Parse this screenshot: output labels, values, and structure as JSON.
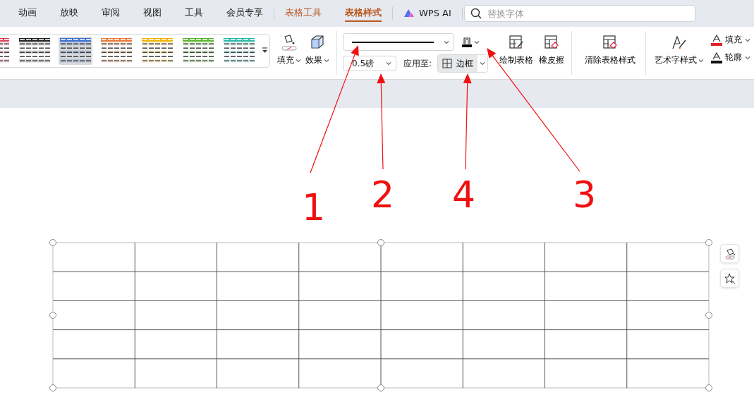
{
  "tabs": [
    {
      "label": "动画",
      "kind": "plain",
      "selected": false
    },
    {
      "label": "放映",
      "kind": "plain",
      "selected": false
    },
    {
      "label": "审阅",
      "kind": "plain",
      "selected": false
    },
    {
      "label": "视图",
      "kind": "plain",
      "selected": false
    },
    {
      "label": "工具",
      "kind": "plain",
      "selected": false
    },
    {
      "label": "会员专享",
      "kind": "plain",
      "selected": false
    },
    {
      "label": "表格工具",
      "kind": "context",
      "selected": false
    },
    {
      "label": "表格样式",
      "kind": "context",
      "selected": true
    },
    {
      "label": "WPS AI",
      "kind": "ai",
      "selected": false
    }
  ],
  "search": {
    "placeholder": "替换字体"
  },
  "table_styles": [
    {
      "color": "#d9435a",
      "selected": false
    },
    {
      "color": "#222222",
      "selected": false
    },
    {
      "color": "#3d6fd1",
      "selected": true
    },
    {
      "color": "#e8783a",
      "selected": false
    },
    {
      "color": "#f0b400",
      "selected": false
    },
    {
      "color": "#5ab52e",
      "selected": false
    },
    {
      "color": "#2bb7a8",
      "selected": false
    }
  ],
  "shading_buttons": [
    {
      "label": "填充",
      "kind": "fill"
    },
    {
      "label": "效果",
      "kind": "effect"
    }
  ],
  "pen_color": {
    "color": "#000000"
  },
  "line_width": {
    "value": "0.5磅"
  },
  "apply_to": {
    "label": "应用至:",
    "value": "边框"
  },
  "draw_buttons": [
    {
      "label": "绘制表格",
      "kind": "draw"
    },
    {
      "label": "橡皮擦",
      "kind": "erase"
    },
    {
      "label": "清除表格样式",
      "kind": "clear"
    }
  ],
  "art_text": {
    "label": "艺术字样式"
  },
  "text_buttons": [
    {
      "label": "填充",
      "color": "#e02020"
    },
    {
      "label": "轮廓",
      "color": "#111111"
    }
  ],
  "table": {
    "selected": true
  },
  "annotations": [
    {
      "label": "1"
    },
    {
      "label": "2"
    },
    {
      "label": "4"
    },
    {
      "label": "3"
    }
  ]
}
